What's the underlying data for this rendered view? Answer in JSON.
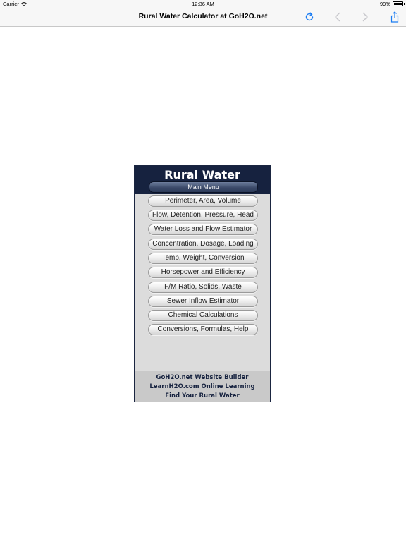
{
  "status_bar": {
    "carrier": "Carrier",
    "time": "12:36 AM",
    "battery": "99%"
  },
  "nav_bar": {
    "title": "Rural Water Calculator at GoH2O.net",
    "icons": {
      "reload": "reload-icon",
      "back": "chevron-left-icon",
      "forward": "chevron-right-icon",
      "share": "share-icon"
    },
    "accent_color": "#1a7cf3",
    "disabled_color": "#c7c7cc"
  },
  "calculator": {
    "title": "Rural Water Calculator",
    "main_menu_label": "Main Menu",
    "menu_items": [
      "Perimeter, Area, Volume",
      "Flow, Detention, Pressure, Head",
      "Water Loss and Flow Estimator",
      "Concentration, Dosage, Loading",
      "Temp, Weight, Conversion",
      "Horsepower and Efficiency",
      "F/M Ratio, Solids, Waste",
      "Sewer Inflow Estimator",
      "Chemical Calculations",
      "Conversions, Formulas, Help"
    ],
    "footer_links": [
      "GoH2O.net Website Builder",
      "LearnH2O.com Online Learning",
      "Find Your Rural Water"
    ],
    "header_color": "#16223f"
  }
}
